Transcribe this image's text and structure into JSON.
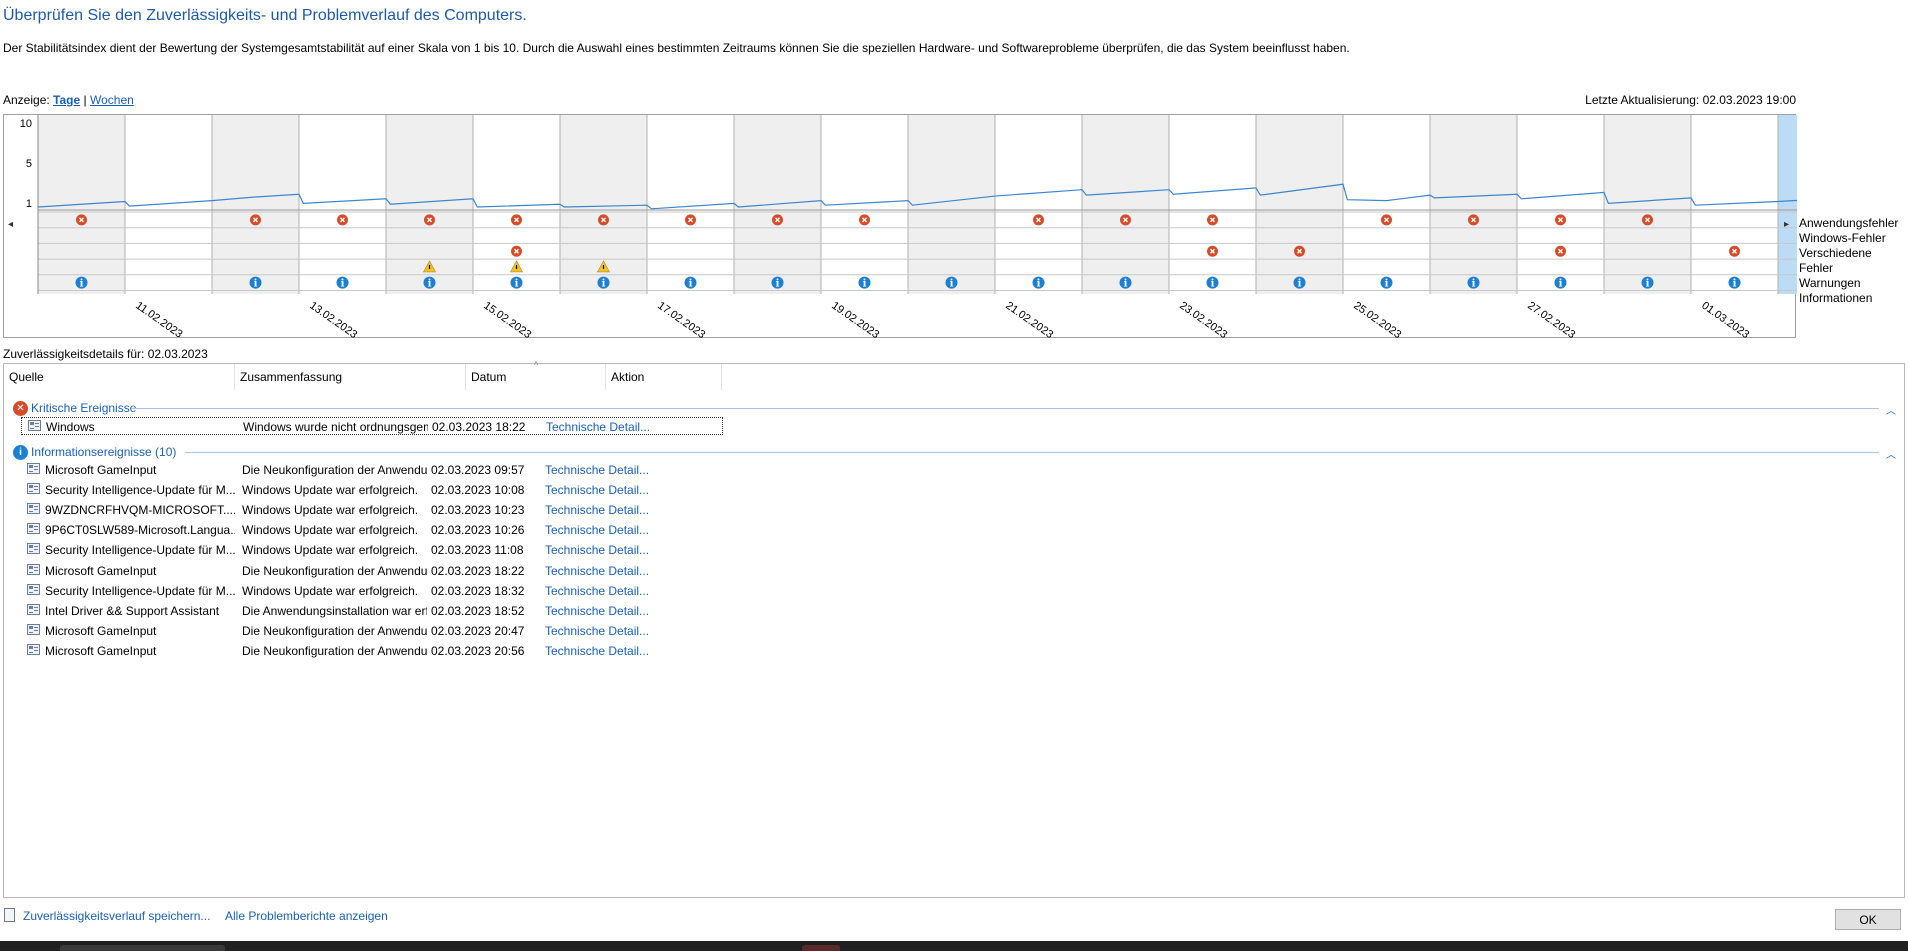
{
  "header": {
    "title": "Überprüfen Sie den Zuverlässigkeits- und Problemverlauf des Computers.",
    "description": "Der Stabilitätsindex dient der Bewertung der Systemgesamtstabilität auf einer Skala von 1 bis 10. Durch die Auswahl eines bestimmten Zeitraums können Sie die speziellen Hardware- und Softwareprobleme überprüfen, die das System beeinflusst haben."
  },
  "view": {
    "label": "Anzeige:",
    "days": "Tage",
    "separator": "|",
    "weeks": "Wochen",
    "last_update": "Letzte Aktualisierung: 02.03.2023 19:00"
  },
  "chart_data": {
    "type": "line",
    "y_ticks": [
      "10",
      "5",
      "1"
    ],
    "ylim": [
      1,
      10
    ],
    "x_labels": [
      "11.02.2023",
      "13.02.2023",
      "15.02.2023",
      "17.02.2023",
      "19.02.2023",
      "21.02.2023",
      "23.02.2023",
      "25.02.2023",
      "27.02.2023",
      "01.03.2023"
    ],
    "days": [
      "10.02",
      "11.02",
      "12.02",
      "13.02",
      "14.02",
      "15.02",
      "16.02",
      "17.02",
      "18.02",
      "19.02",
      "20.02",
      "21.02",
      "22.02",
      "23.02",
      "24.02",
      "25.02",
      "26.02",
      "27.02",
      "28.02",
      "01.03",
      "02.03"
    ],
    "selected_day": "02.03",
    "stability_points": [
      [
        0.0,
        1.0
      ],
      [
        0.5,
        1.3
      ],
      [
        1.0,
        1.6
      ],
      [
        1.05,
        1.1
      ],
      [
        2.0,
        1.7
      ],
      [
        2.5,
        2.1
      ],
      [
        3.0,
        2.4
      ],
      [
        3.05,
        1.4
      ],
      [
        4.0,
        1.9
      ],
      [
        4.05,
        1.3
      ],
      [
        5.0,
        1.9
      ],
      [
        5.05,
        1.0
      ],
      [
        6.0,
        1.3
      ],
      [
        6.05,
        1.0
      ],
      [
        7.0,
        1.2
      ],
      [
        7.05,
        0.8
      ],
      [
        8.0,
        1.4
      ],
      [
        8.05,
        1.0
      ],
      [
        9.0,
        1.7
      ],
      [
        9.05,
        1.2
      ],
      [
        10.0,
        1.7
      ],
      [
        10.05,
        1.2
      ],
      [
        11.0,
        2.2
      ],
      [
        12.0,
        2.9
      ],
      [
        12.05,
        2.3
      ],
      [
        13.0,
        2.9
      ],
      [
        13.05,
        2.4
      ],
      [
        14.0,
        3.1
      ],
      [
        14.05,
        2.3
      ],
      [
        15.0,
        3.5
      ],
      [
        15.05,
        1.8
      ],
      [
        15.5,
        1.7
      ],
      [
        16.0,
        2.3
      ],
      [
        16.05,
        2.0
      ],
      [
        17.0,
        2.4
      ],
      [
        17.05,
        1.9
      ],
      [
        18.0,
        2.6
      ],
      [
        18.05,
        1.4
      ],
      [
        19.0,
        2.0
      ],
      [
        19.05,
        1.2
      ],
      [
        20.0,
        1.6
      ],
      [
        20.5,
        1.9
      ],
      [
        21.0,
        1.8
      ]
    ],
    "rows": [
      "Anwendungsfehler",
      "Windows-Fehler",
      "Verschiedene Fehler",
      "Warnungen",
      "Informationen"
    ],
    "app_errors_days": [
      0.5,
      2.5,
      3.5,
      4.5,
      5.5,
      6.5,
      7.5,
      8.5,
      9.5,
      11.5,
      12.5,
      13.5,
      15.5,
      16.5,
      17.5,
      18.5
    ],
    "misc_errors_days": [
      5.5,
      13.5,
      14.5,
      17.5,
      19.5
    ],
    "warning_days": [
      4.5,
      5.5,
      6.5
    ],
    "info_days": [
      0.5,
      2.5,
      3.5,
      4.5,
      5.5,
      6.5,
      7.5,
      8.5,
      9.5,
      10.5,
      11.5,
      12.5,
      13.5,
      14.5,
      15.5,
      16.5,
      17.5,
      18.5,
      19.5
    ]
  },
  "details": {
    "label": "Zuverlässigkeitsdetails für: 02.03.2023",
    "columns": [
      "Quelle",
      "Zusammenfassung",
      "Datum",
      "Aktion"
    ],
    "critical_group": "Kritische Ereignisse",
    "critical_events": [
      {
        "source": "Windows",
        "summary": "Windows wurde nicht ordnungsgemäß ...",
        "date": "02.03.2023 18:22",
        "action": "Technische Detail..."
      }
    ],
    "info_group": "Informationsereignisse (10)",
    "info_events": [
      {
        "source": "Microsoft GameInput",
        "summary": "Die Neukonfiguration der Anwendung ...",
        "date": "02.03.2023 09:57",
        "action": "Technische Detail..."
      },
      {
        "source": "Security Intelligence-Update für M...",
        "summary": "Windows Update war erfolgreich.",
        "date": "02.03.2023 10:08",
        "action": "Technische Detail..."
      },
      {
        "source": "9WZDNCRFHVQM-MICROSOFT....",
        "summary": "Windows Update war erfolgreich.",
        "date": "02.03.2023 10:23",
        "action": "Technische Detail..."
      },
      {
        "source": "9P6CT0SLW589-Microsoft.Langua...",
        "summary": "Windows Update war erfolgreich.",
        "date": "02.03.2023 10:26",
        "action": "Technische Detail..."
      },
      {
        "source": "Security Intelligence-Update für M...",
        "summary": "Windows Update war erfolgreich.",
        "date": "02.03.2023 11:08",
        "action": "Technische Detail..."
      },
      {
        "source": "Microsoft GameInput",
        "summary": "Die Neukonfiguration der Anwendung ...",
        "date": "02.03.2023 18:22",
        "action": "Technische Detail..."
      },
      {
        "source": "Security Intelligence-Update für M...",
        "summary": "Windows Update war erfolgreich.",
        "date": "02.03.2023 18:32",
        "action": "Technische Detail..."
      },
      {
        "source": "Intel Driver && Support Assistant",
        "summary": "Die Anwendungsinstallation war erfolgr...",
        "date": "02.03.2023 18:52",
        "action": "Technische Detail..."
      },
      {
        "source": "Microsoft GameInput",
        "summary": "Die Neukonfiguration der Anwendung ...",
        "date": "02.03.2023 20:47",
        "action": "Technische Detail..."
      },
      {
        "source": "Microsoft GameInput",
        "summary": "Die Neukonfiguration der Anwendung ...",
        "date": "02.03.2023 20:56",
        "action": "Technische Detail..."
      }
    ]
  },
  "footer": {
    "save_link": "Zuverlässigkeitsverlauf speichern...",
    "all_reports_link": "Alle Problemberichte anzeigen",
    "ok_label": "OK"
  },
  "icons": {
    "error": "error-icon",
    "warning": "warning-icon",
    "info": "info-icon"
  },
  "colors": {
    "accent": "#1e5aa8",
    "link": "#1a5fb4",
    "error": "#d64b29",
    "warning": "#f2c12e",
    "info": "#1c7fd1",
    "line": "#3a86d0",
    "selected_column": "#bcdcf5"
  }
}
